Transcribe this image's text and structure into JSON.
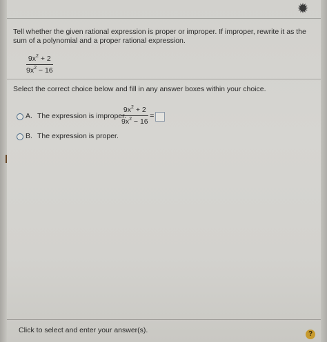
{
  "header": {
    "settings_icon": "gear-icon"
  },
  "question": {
    "prompt": "Tell whether the given rational expression is proper or improper. If improper, rewrite it as the sum of a polynomial and a proper rational expression.",
    "expression": {
      "numerator_base": "9x",
      "numerator_exp": "2",
      "numerator_rest": " + 2",
      "denominator_base": "9x",
      "denominator_exp": "2",
      "denominator_rest": " − 16"
    }
  },
  "instruction": "Select the correct choice below and fill in any answer boxes within your choice.",
  "choices": [
    {
      "letter": "A.",
      "text": "The expression is improper.",
      "equals": "=",
      "selected": false
    },
    {
      "letter": "B.",
      "text": "The expression is proper.",
      "selected": false
    }
  ],
  "footer": {
    "status": "Click to select and enter your answer(s).",
    "help_label": "?"
  },
  "colors": {
    "background": "#d4d3cf",
    "radio_border": "#4a6c8a",
    "help_badge": "#c79a2e"
  }
}
